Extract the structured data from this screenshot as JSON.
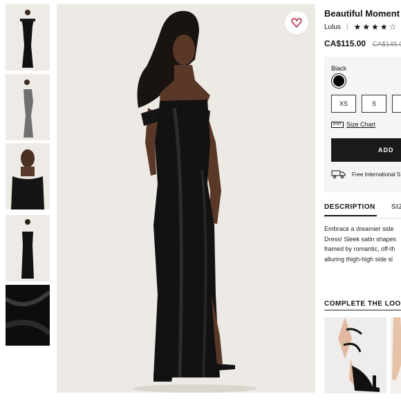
{
  "product": {
    "title": "Beautiful Moment",
    "brand": "Lulus",
    "separator": "|",
    "rating": {
      "filled": 4,
      "total": 5
    },
    "price_current": "CA$115.00",
    "price_original": "CA$145.0"
  },
  "options": {
    "color_label": "Black",
    "color_hex": "#000000",
    "sizes": [
      "XS",
      "S"
    ],
    "size_chart_label": "Size Chart",
    "add_label": "ADD",
    "shipping_label": "Free International S"
  },
  "tabs": [
    "DESCRIPTION",
    "SIZ"
  ],
  "description": [
    "Embrace a dreamier side",
    "Dress! Sleek satin shapes",
    "framed by romantic, off-th",
    "alluring thigh-high side sl"
  ],
  "complete_the_look": "COMPLETE THE LOO",
  "image_caption": "",
  "colors": {
    "accent_heart": "#b2283a",
    "button_dark": "#1a1a1a",
    "panel_bg": "#f5f5f5"
  },
  "icons": [
    "heart-icon",
    "ruler-icon",
    "truck-icon",
    "star-icon"
  ]
}
